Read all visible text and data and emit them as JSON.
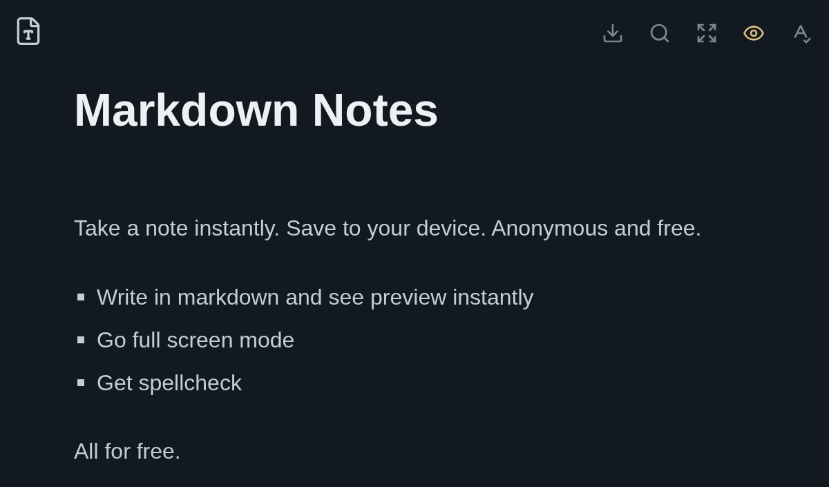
{
  "toolbar": [
    {
      "kind": "download",
      "active": false
    },
    {
      "kind": "search",
      "active": false
    },
    {
      "kind": "fullscreen",
      "active": false
    },
    {
      "kind": "preview",
      "active": true
    },
    {
      "kind": "spellcheck",
      "active": false
    }
  ],
  "document": {
    "title": "Markdown Notes",
    "blocks": [
      {
        "kind": "paragraph",
        "text": "Take a note instantly. Save to your device. Anonymous and free."
      },
      {
        "kind": "list",
        "items": [
          "Write in markdown and see preview instantly",
          "Go full screen mode",
          "Get spellcheck"
        ]
      },
      {
        "kind": "paragraph",
        "text": "All for free."
      }
    ]
  }
}
